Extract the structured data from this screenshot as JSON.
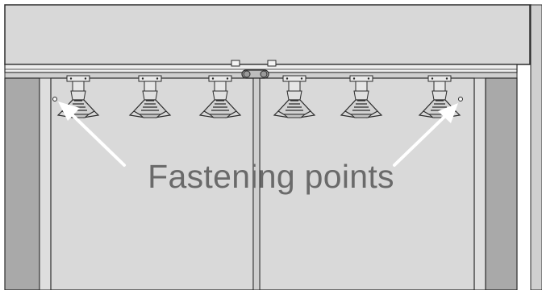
{
  "diagram": {
    "annotation_label": "Fastening points",
    "hook_count": 6,
    "colors": {
      "background": "#d6d6d6",
      "panel_face": "#d9d9d9",
      "rail": "#ededed",
      "dark_column": "#a8a8a8",
      "line": "#2b2b2b",
      "arrow": "#ffffff",
      "label": "#6a6a6a"
    }
  }
}
